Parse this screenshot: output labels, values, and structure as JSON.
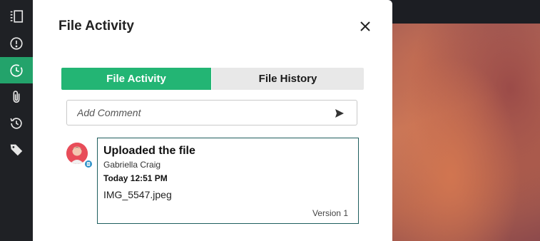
{
  "sidebar": {
    "items": [
      {
        "icon": "panel-list-icon",
        "active": false
      },
      {
        "icon": "alert-circle-icon",
        "active": false
      },
      {
        "icon": "clock-icon",
        "active": true
      },
      {
        "icon": "paperclip-icon",
        "active": false
      },
      {
        "icon": "history-icon",
        "active": false
      },
      {
        "icon": "tag-icon",
        "active": false
      }
    ],
    "active_color": "#23a36b"
  },
  "panel": {
    "title": "File Activity",
    "close_icon": "close-icon"
  },
  "tabs": [
    {
      "label": "File Activity",
      "active": true
    },
    {
      "label": "File History",
      "active": false
    }
  ],
  "comment": {
    "placeholder": "Add Comment",
    "value": "",
    "send_icon": "send-icon"
  },
  "activity": {
    "title": "Uploaded the file",
    "user": "Gabriella Craig",
    "time": "Today 12:51 PM",
    "file": "IMG_5547.jpeg",
    "version": "Version 1",
    "avatar_color": "#e84d59",
    "badge_color": "#2a8fc7"
  },
  "colors": {
    "accent": "#23b574",
    "card_border": "#1e5e5e"
  }
}
